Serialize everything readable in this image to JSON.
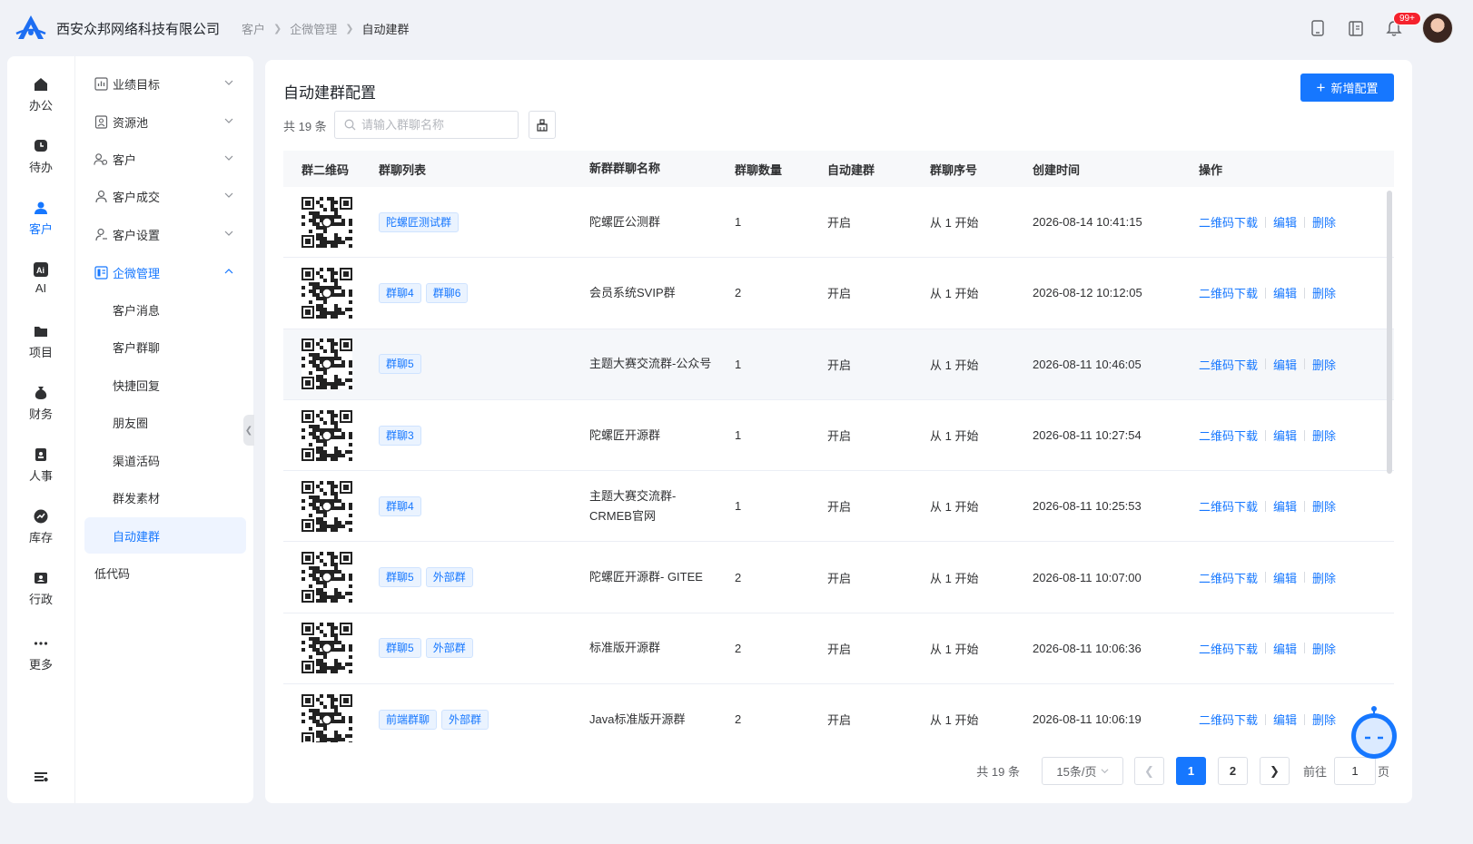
{
  "header": {
    "company": "西安众邦网络科技有限公司",
    "breadcrumb": [
      "客户",
      "企微管理",
      "自动建群"
    ],
    "notification_badge": "99+",
    "icons": [
      "mobile-icon",
      "book-icon",
      "bell-icon"
    ]
  },
  "rail": {
    "items": [
      {
        "label": "办公",
        "icon": "home-icon"
      },
      {
        "label": "待办",
        "icon": "todo-icon"
      },
      {
        "label": "客户",
        "icon": "customer-icon",
        "active": true
      },
      {
        "label": "AI",
        "icon": "ai-icon"
      },
      {
        "label": "项目",
        "icon": "folder-icon"
      },
      {
        "label": "财务",
        "icon": "money-bag-icon"
      },
      {
        "label": "人事",
        "icon": "badge-icon"
      },
      {
        "label": "库存",
        "icon": "chart-icon"
      },
      {
        "label": "行政",
        "icon": "id-card-icon"
      },
      {
        "label": "更多",
        "icon": "more-icon"
      }
    ],
    "bottom_icon": "settings-list-icon"
  },
  "submenu": {
    "groups": [
      {
        "label": "业绩目标",
        "icon": "target-chart-icon"
      },
      {
        "label": "资源池",
        "icon": "resource-icon"
      },
      {
        "label": "客户",
        "icon": "user-group-icon"
      },
      {
        "label": "客户成交",
        "icon": "user-deal-icon"
      },
      {
        "label": "客户设置",
        "icon": "user-settings-icon"
      },
      {
        "label": "企微管理",
        "icon": "wecom-icon",
        "expanded": true
      }
    ],
    "children": [
      "客户消息",
      "客户群聊",
      "快捷回复",
      "朋友圈",
      "渠道活码",
      "群发素材",
      "自动建群"
    ],
    "selected_child": "自动建群",
    "extra": "低代码"
  },
  "main": {
    "title": "自动建群配置",
    "add_button": "新增配置",
    "total_label": "共 19 条",
    "search_placeholder": "请输入群聊名称"
  },
  "table": {
    "columns": [
      "群二维码",
      "群聊列表",
      "新群群聊名称",
      "群聊数量",
      "自动建群",
      "群聊序号",
      "创建时间",
      "操作"
    ],
    "actions": [
      "二维码下载",
      "编辑",
      "删除"
    ],
    "rows": [
      {
        "tags": [
          "陀螺匠测试群"
        ],
        "name": "陀螺匠公测群",
        "count": "1",
        "auto": "开启",
        "seq": "从 1 开始",
        "created": "2026-08-14 10:41:15"
      },
      {
        "tags": [
          "群聊4",
          "群聊6"
        ],
        "name": "会员系统SVIP群",
        "count": "2",
        "auto": "开启",
        "seq": "从 1 开始",
        "created": "2026-08-12 10:12:05"
      },
      {
        "tags": [
          "群聊5"
        ],
        "name": "主题大赛交流群-公众号",
        "count": "1",
        "auto": "开启",
        "seq": "从 1 开始",
        "created": "2026-08-11 10:46:05"
      },
      {
        "tags": [
          "群聊3"
        ],
        "name": "陀螺匠开源群",
        "count": "1",
        "auto": "开启",
        "seq": "从 1 开始",
        "created": "2026-08-11 10:27:54"
      },
      {
        "tags": [
          "群聊4"
        ],
        "name": "主题大赛交流群-CRMEB官网",
        "count": "1",
        "auto": "开启",
        "seq": "从 1 开始",
        "created": "2026-08-11 10:25:53"
      },
      {
        "tags": [
          "群聊5",
          "外部群"
        ],
        "name": "陀螺匠开源群- GITEE",
        "count": "2",
        "auto": "开启",
        "seq": "从 1 开始",
        "created": "2026-08-11 10:07:00"
      },
      {
        "tags": [
          "群聊5",
          "外部群"
        ],
        "name": "标准版开源群",
        "count": "2",
        "auto": "开启",
        "seq": "从 1 开始",
        "created": "2026-08-11 10:06:36"
      },
      {
        "tags": [
          "前端群聊",
          "外部群"
        ],
        "name": "Java标准版开源群",
        "count": "2",
        "auto": "开启",
        "seq": "从 1 开始",
        "created": "2026-08-11 10:06:19"
      }
    ]
  },
  "pagination": {
    "total": "共 19 条",
    "page_size": "15条/页",
    "pages": [
      "1",
      "2"
    ],
    "current": "1",
    "goto_label": "前往",
    "goto_value": "1",
    "goto_unit": "页"
  },
  "colors": {
    "primary": "#1677ff",
    "background": "#f0f2f7"
  }
}
